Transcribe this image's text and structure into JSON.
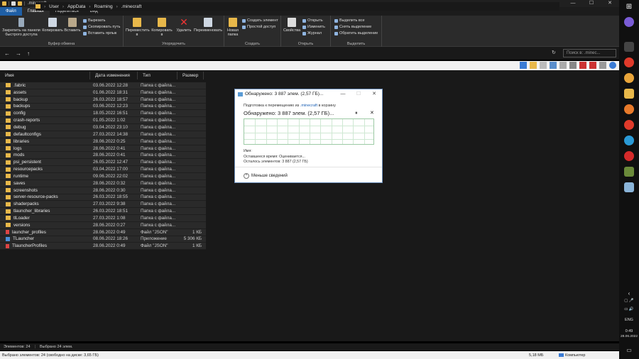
{
  "window": {
    "title": ".minecraft",
    "controls": [
      "—",
      "☐",
      "✕"
    ]
  },
  "ribbon_tabs": [
    "Файл",
    "Главная",
    "Поделиться",
    "Вид"
  ],
  "ribbon": {
    "clipboard": {
      "pin": "Закрепить на панели быстрого доступа",
      "copy": "Копировать",
      "paste": "Вставить",
      "cut": "Вырезать",
      "copy_path": "Скопировать путь",
      "paste_shortcut": "Вставить ярлык",
      "label": "Буфер обмена"
    },
    "organize": {
      "move": "Переместить в",
      "copy_to": "Копировать в",
      "delete": "Удалить",
      "rename": "Переименовать",
      "label": "Упорядочить"
    },
    "create": {
      "new_folder": "Новая папка",
      "new_item": "Создать элемент",
      "easy_access": "Простой доступ",
      "label": "Создать"
    },
    "open": {
      "properties": "Свойства",
      "open": "Открыть",
      "edit": "Изменить",
      "history": "Журнал",
      "label": "Открыть"
    },
    "select": {
      "select_all": "Выделить все",
      "select_none": "Снять выделение",
      "invert": "Обратить выделение",
      "label": "Выделить"
    }
  },
  "address": {
    "crumbs": [
      "User",
      "AppData",
      "Roaming",
      ".minecraft"
    ],
    "search_placeholder": "Поиск в: .minec..."
  },
  "columns": [
    "Имя",
    "Дата изменения",
    "Тип",
    "Размер"
  ],
  "files": [
    {
      "name": ".fabric",
      "date": "03.06.2022 12:28",
      "type": "Папка с файла...",
      "size": "",
      "kind": "folder"
    },
    {
      "name": "assets",
      "date": "01.06.2022 18:31",
      "type": "Папка с файла...",
      "size": "",
      "kind": "folder"
    },
    {
      "name": "backup",
      "date": "26.03.2022 18:57",
      "type": "Папка с файла...",
      "size": "",
      "kind": "folder"
    },
    {
      "name": "backups",
      "date": "03.06.2022 12:23",
      "type": "Папка с файла...",
      "size": "",
      "kind": "folder"
    },
    {
      "name": "config",
      "date": "18.05.2022 16:51",
      "type": "Папка с файла...",
      "size": "",
      "kind": "folder"
    },
    {
      "name": "crash-reports",
      "date": "01.05.2022 1:02",
      "type": "Папка с файла...",
      "size": "",
      "kind": "folder"
    },
    {
      "name": "debug",
      "date": "03.04.2022 23:10",
      "type": "Папка с файла...",
      "size": "",
      "kind": "folder"
    },
    {
      "name": "defaultconfigs",
      "date": "27.03.2022 14:38",
      "type": "Папка с файла...",
      "size": "",
      "kind": "folder"
    },
    {
      "name": "libraries",
      "date": "28.06.2022 0:25",
      "type": "Папка с файла...",
      "size": "",
      "kind": "folder"
    },
    {
      "name": "logs",
      "date": "28.06.2022 0:41",
      "type": "Папка с файла...",
      "size": "",
      "kind": "folder"
    },
    {
      "name": "mods",
      "date": "28.06.2022 0:41",
      "type": "Папка с файла...",
      "size": "",
      "kind": "folder"
    },
    {
      "name": "psi_persistent",
      "date": "26.05.2022 12:47",
      "type": "Папка с файла...",
      "size": "",
      "kind": "folder"
    },
    {
      "name": "resourcepacks",
      "date": "03.04.2022 17:00",
      "type": "Папка с файла...",
      "size": "",
      "kind": "folder"
    },
    {
      "name": "runtime",
      "date": "09.06.2022 22:02",
      "type": "Папка с файла...",
      "size": "",
      "kind": "folder"
    },
    {
      "name": "saves",
      "date": "28.06.2022 0:32",
      "type": "Папка с файла...",
      "size": "",
      "kind": "folder"
    },
    {
      "name": "screenshots",
      "date": "28.06.2022 0:30",
      "type": "Папка с файла...",
      "size": "",
      "kind": "folder"
    },
    {
      "name": "server-resource-packs",
      "date": "26.03.2022 18:55",
      "type": "Папка с файла...",
      "size": "",
      "kind": "folder"
    },
    {
      "name": "shaderpacks",
      "date": "27.03.2022 9:38",
      "type": "Папка с файла...",
      "size": "",
      "kind": "folder"
    },
    {
      "name": "tlauncher_libraries",
      "date": "26.03.2022 18:51",
      "type": "Папка с файла...",
      "size": "",
      "kind": "folder"
    },
    {
      "name": "tlLoader",
      "date": "27.03.2022 1:08",
      "type": "Папка с файла...",
      "size": "",
      "kind": "folder"
    },
    {
      "name": "versions",
      "date": "28.06.2022 0:27",
      "type": "Папка с файла...",
      "size": "",
      "kind": "folder"
    },
    {
      "name": "launcher_profiles",
      "date": "28.06.2022 0:49",
      "type": "Файл \"JSON\"",
      "size": "1 КБ",
      "kind": "json"
    },
    {
      "name": "TLauncher",
      "date": "08.06.2022 18:26",
      "type": "Приложение",
      "size": "5 306 КБ",
      "kind": "app"
    },
    {
      "name": "TlauncherProfiles",
      "date": "28.06.2022 0:49",
      "type": "Файл \"JSON\"",
      "size": "1 КБ",
      "kind": "json"
    }
  ],
  "status": {
    "count": "Элементов: 24",
    "selected": "Выбрано 24 элем.",
    "bottom_left": "Выбрано элементов: 24 (свободно на диске: 3,65 ГБ)",
    "bottom_size": "5,18 МБ",
    "bottom_pc": "Компьютер"
  },
  "dialog": {
    "title": "Обнаружено: 3 887 элем. (2,57 ГБ)...",
    "sub_prefix": "Подготовка к перемещению из",
    "sub_link": ".minecraft",
    "sub_suffix": "в корзину",
    "big": "Обнаружено: 3 887 элем. (2,57 ГБ)...",
    "name_label": "Имя:",
    "remaining_time": "Оставшееся время: Оценивается...",
    "remaining_items": "Осталось элементов: 3 887 (2,57 ГБ)",
    "less": "Меньше сведений",
    "pause": "⏸",
    "close": "✕"
  },
  "taskbar": {
    "lang": "ENG",
    "time": "0:49",
    "date": "28.06.2022"
  }
}
